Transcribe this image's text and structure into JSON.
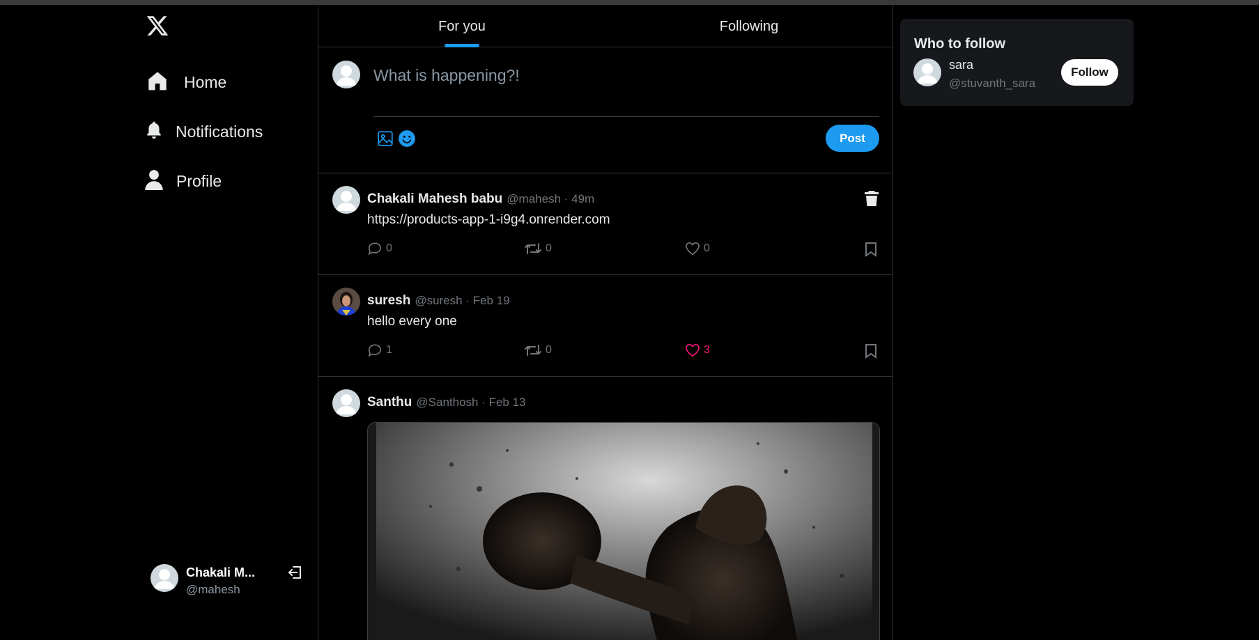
{
  "sidebar": {
    "logo_icon": "x-logo-icon",
    "nav": [
      {
        "label": "Home",
        "icon": "home-icon"
      },
      {
        "label": "Notifications",
        "icon": "bell-icon"
      },
      {
        "label": "Profile",
        "icon": "user-icon"
      }
    ],
    "account": {
      "name": "Chakali M...",
      "handle": "@mahesh",
      "logout_icon": "logout-icon"
    }
  },
  "feed": {
    "tabs": [
      {
        "label": "For you",
        "active": true
      },
      {
        "label": "Following",
        "active": false
      }
    ],
    "composer": {
      "placeholder": "What is happening?!",
      "post_label": "Post",
      "accent": "#1d9bf0"
    },
    "tweets": [
      {
        "name": "Chakali Mahesh babu",
        "meta": "@mahesh · 49m",
        "text": "https://products-app-1-i9g4.onrender.com",
        "replies": "0",
        "retweets": "0",
        "likes": "0",
        "liked": false,
        "deletable": true
      },
      {
        "name": "suresh",
        "meta": "@suresh · Feb 19",
        "text": "hello every one",
        "replies": "1",
        "retweets": "0",
        "likes": "3",
        "liked": true,
        "like_color": "#f91880"
      },
      {
        "name": "Santhu",
        "meta": "@Santhosh · Feb 13",
        "has_image": true
      }
    ]
  },
  "who_to_follow": {
    "title": "Who to follow",
    "users": [
      {
        "name": "sara",
        "handle": "@stuvanth_sara",
        "button": "Follow"
      }
    ]
  }
}
